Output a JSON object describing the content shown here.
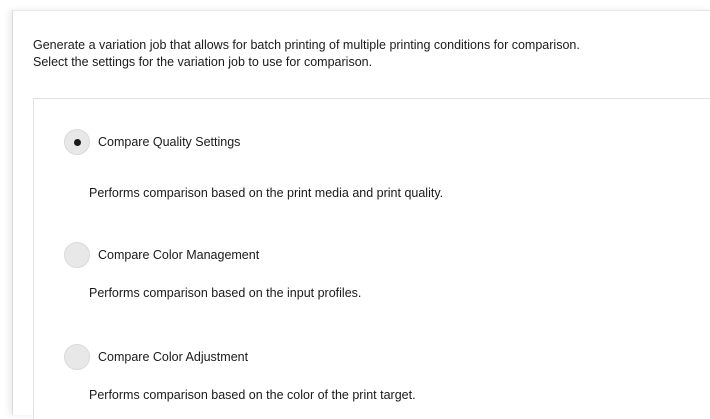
{
  "intro": {
    "line1": "Generate a variation job that allows for batch printing of multiple printing conditions for comparison.",
    "line2": "Select the settings for the variation job to use for comparison."
  },
  "options": [
    {
      "label": "Compare Quality Settings",
      "description": "Performs comparison based on the print media and print quality.",
      "selected": true
    },
    {
      "label": "Compare Color Management",
      "description": "Performs comparison based on the input profiles.",
      "selected": false
    },
    {
      "label": "Compare Color Adjustment",
      "description": "Performs comparison based on the color of the print target.",
      "selected": false
    }
  ]
}
